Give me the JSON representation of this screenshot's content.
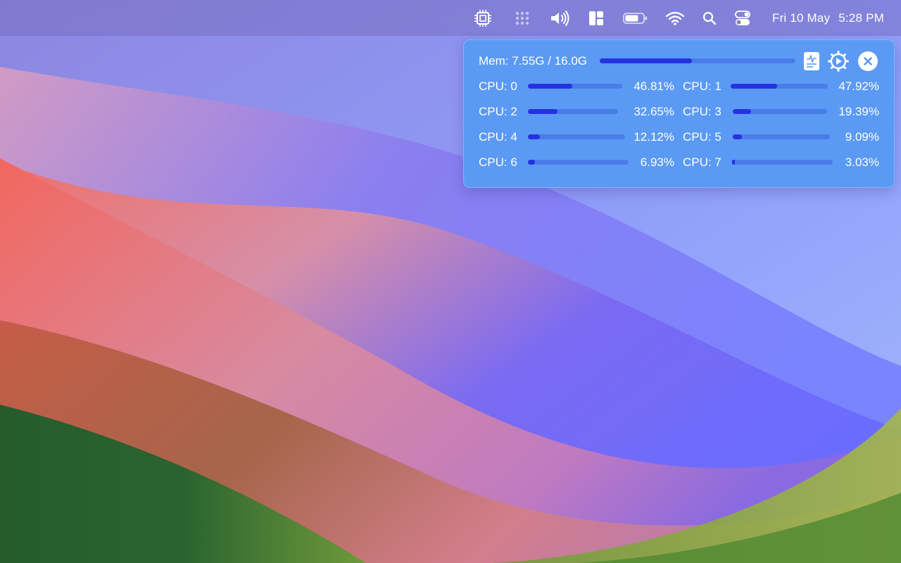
{
  "colors": {
    "panel_bg": "#5b9af4",
    "bar_fill": "#2532e0",
    "bar_track": "#3f6fe0"
  },
  "menubar": {
    "icons": [
      "cpu-chip-icon",
      "dots-grid-icon",
      "speaker-volume-icon",
      "layout-grid-icon",
      "battery-icon",
      "wifi-icon",
      "search-icon",
      "control-center-icon"
    ],
    "date": "Fri 10 May",
    "time": "5:28 PM"
  },
  "monitor": {
    "memory": {
      "label": "Mem: 7.55G / 16.0G",
      "used_fraction": 0.4719
    },
    "buttons": [
      "activity-monitor-icon",
      "settings-gear-icon",
      "close-icon"
    ],
    "cpus": [
      {
        "label": "CPU: 0",
        "value": "46.81%",
        "fraction": 0.4681
      },
      {
        "label": "CPU: 1",
        "value": "47.92%",
        "fraction": 0.4792
      },
      {
        "label": "CPU: 2",
        "value": "32.65%",
        "fraction": 0.3265
      },
      {
        "label": "CPU: 3",
        "value": "19.39%",
        "fraction": 0.1939
      },
      {
        "label": "CPU: 4",
        "value": "12.12%",
        "fraction": 0.1212
      },
      {
        "label": "CPU: 5",
        "value": "9.09%",
        "fraction": 0.0909
      },
      {
        "label": "CPU: 6",
        "value": "6.93%",
        "fraction": 0.0693
      },
      {
        "label": "CPU: 7",
        "value": "3.03%",
        "fraction": 0.0303
      }
    ]
  }
}
